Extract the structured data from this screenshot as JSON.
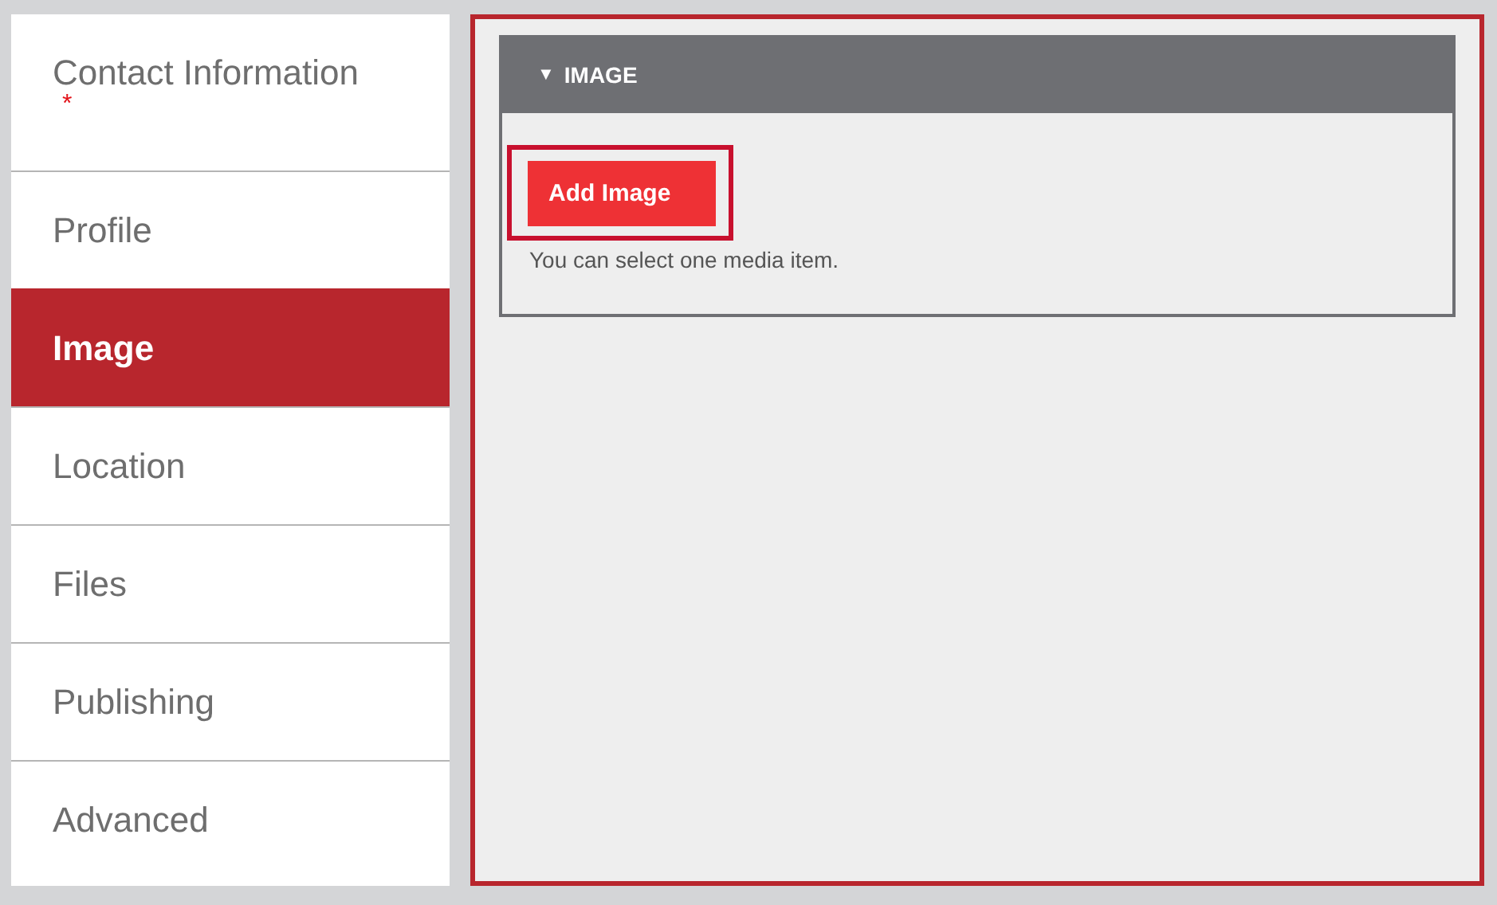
{
  "sidebar": {
    "items": [
      {
        "label": "Contact Information",
        "required_mark": "*",
        "selected": false
      },
      {
        "label": "Profile",
        "selected": false
      },
      {
        "label": "Image",
        "selected": true
      },
      {
        "label": "Location",
        "selected": false
      },
      {
        "label": "Files",
        "selected": false
      },
      {
        "label": "Publishing",
        "selected": false
      },
      {
        "label": "Advanced",
        "selected": false
      }
    ]
  },
  "section": {
    "toggle": "▼",
    "title": "IMAGE",
    "expanded": true,
    "button": {
      "label": "Add Image",
      "focused": true
    },
    "hint": "You can select one media item."
  }
}
